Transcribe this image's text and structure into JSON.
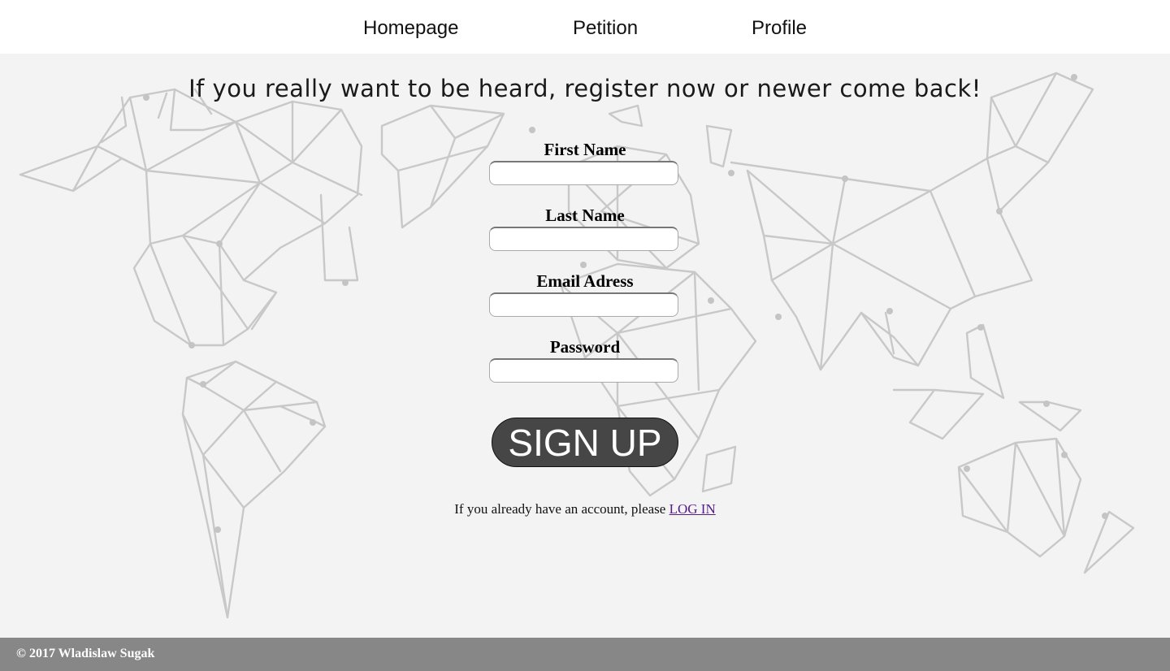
{
  "nav": {
    "items": [
      {
        "label": "Homepage"
      },
      {
        "label": "Petition"
      },
      {
        "label": "Profile"
      }
    ]
  },
  "main": {
    "headline": "If you really want to be heard, register now or newer come back!",
    "form": {
      "fields": [
        {
          "label": "First Name",
          "value": "",
          "placeholder": ""
        },
        {
          "label": "Last Name",
          "value": "",
          "placeholder": ""
        },
        {
          "label": "Email Adress",
          "value": "",
          "placeholder": ""
        },
        {
          "label": "Password",
          "value": "",
          "placeholder": ""
        }
      ],
      "submit_label": "SIGN UP"
    },
    "login_prompt": {
      "text": "If you already have an account, please ",
      "link_label": "LOG IN"
    },
    "background_icon": "world-map-line-art"
  },
  "footer": {
    "copyright": "© 2017 Wladislaw Sugak"
  },
  "colors": {
    "nav_bg": "#ffffff",
    "page_bg": "#f3f3f3",
    "map_lines": "#c2c2c2",
    "button_bg": "#464646",
    "button_text": "#ffffff",
    "link": "#551a8b",
    "footer_bg": "#878787"
  }
}
